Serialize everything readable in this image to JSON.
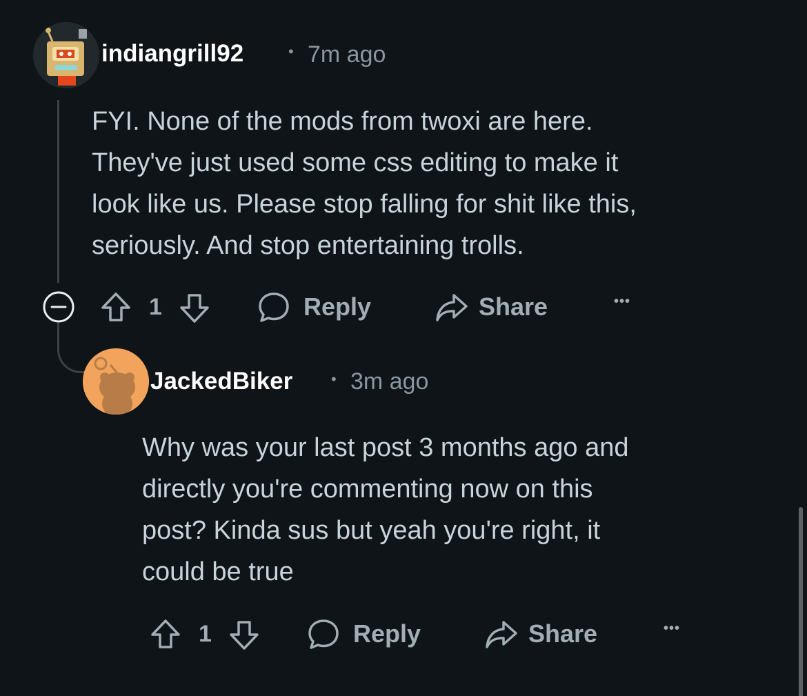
{
  "comments": [
    {
      "username": "indiangrill92",
      "dot": "•",
      "timestamp": "7m ago",
      "body_lines": [
        "FYI. None of the mods from twoxi are here.",
        "They've just used some css editing to make it",
        "look like us. Please stop falling for shit like this,",
        "seriously. And stop entertaining trolls."
      ],
      "vote_count": "1",
      "reply_label": "Reply",
      "share_label": "Share",
      "more_label": "•••"
    },
    {
      "username": "JackedBiker",
      "dot": "•",
      "timestamp": "3m ago",
      "body_lines": [
        "Why was your last post 3 months ago and",
        "directly you're commenting now on this",
        "post? Kinda sus but yeah you're right, it",
        "could be true"
      ],
      "vote_count": "1",
      "reply_label": "Reply",
      "share_label": "Share",
      "more_label": "•••"
    }
  ],
  "icons": {
    "collapse": "collapse-minus-icon",
    "upvote": "upvote-arrow-icon",
    "downvote": "downvote-arrow-icon",
    "reply": "speech-bubble-icon",
    "share": "share-arrow-icon",
    "more": "more-dots-icon"
  },
  "colors": {
    "background": "#0e1417",
    "text": "#c8d3da",
    "muted": "#8a979f",
    "action": "#a2adb4",
    "avatar2_bg": "#f2a35c"
  }
}
